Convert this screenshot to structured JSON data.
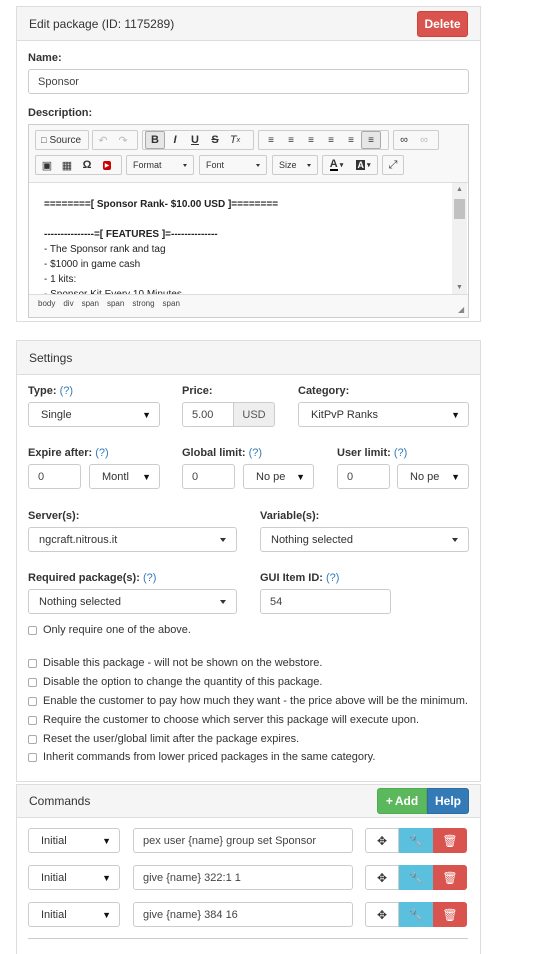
{
  "header": {
    "title": "Edit package (ID: 1175289)",
    "delete_label": "Delete"
  },
  "name": {
    "label": "Name:",
    "value": "Sponsor"
  },
  "description": {
    "label": "Description:",
    "toolbar": {
      "source_label": "Source",
      "format_label": "Format",
      "font_label": "Font",
      "size_label": "Size"
    },
    "content": [
      "========[ Sponsor Rank- $10.00 USD ]========",
      "",
      "---------------=[ FEATURES ]=--------------",
      "- The Sponsor rank and tag",
      "- $1000 in game cash",
      "- 1 kits:",
      "- Sponsor Kit Every 10 Minutes"
    ],
    "path": [
      "body",
      "div",
      "span",
      "span",
      "strong",
      "span"
    ]
  },
  "settings": {
    "title": "Settings",
    "type": {
      "label": "Type:",
      "help": "(?)",
      "value": "Single"
    },
    "price": {
      "label": "Price:",
      "value": "5.00",
      "currency": "USD"
    },
    "category": {
      "label": "Category:",
      "value": "KitPvP Ranks"
    },
    "expire": {
      "label": "Expire after:",
      "help": "(?)",
      "value": "0",
      "unit": "Montl"
    },
    "global_limit": {
      "label": "Global limit:",
      "help": "(?)",
      "value": "0",
      "period": "No pe"
    },
    "user_limit": {
      "label": "User limit:",
      "help": "(?)",
      "value": "0",
      "period": "No pe"
    },
    "servers": {
      "label": "Server(s):",
      "value": "ngcraft.nitrous.it"
    },
    "variables": {
      "label": "Variable(s):",
      "value": "Nothing selected"
    },
    "required": {
      "label": "Required package(s):",
      "help": "(?)",
      "value": "Nothing selected"
    },
    "gui_item": {
      "label": "GUI Item ID:",
      "help": "(?)",
      "value": "54"
    },
    "only_one_label": "Only require one of the above.",
    "options": [
      "Disable this package - will not be shown on the webstore.",
      "Disable the option to change the quantity of this package.",
      "Enable the customer to pay how much they want - the price above will be the minimum.",
      "Require the customer to choose which server this package will execute upon.",
      "Reset the user/global limit after the package expires.",
      "Inherit commands from lower priced packages in the same category."
    ]
  },
  "commands": {
    "title": "Commands",
    "add_label": "Add",
    "help_label": "Help",
    "rows": [
      {
        "trigger": "Initial",
        "command": "pex user {name} group set Sponsor"
      },
      {
        "trigger": "Initial",
        "command": "give {name} 322:1 1"
      },
      {
        "trigger": "Initial",
        "command": "give {name} 384 16"
      }
    ]
  },
  "colors": {
    "danger": "#d9534f",
    "success": "#5cb85c",
    "primary": "#337ab7",
    "info": "#5bc0de"
  }
}
